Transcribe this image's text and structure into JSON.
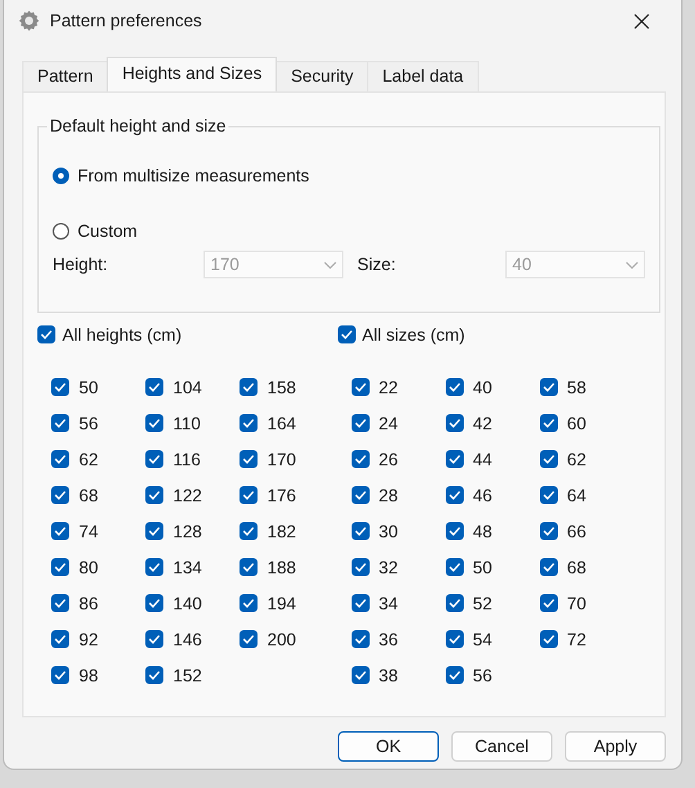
{
  "window": {
    "title": "Pattern preferences"
  },
  "tabs": [
    {
      "label": "Pattern",
      "selected": false
    },
    {
      "label": "Heights and Sizes",
      "selected": true
    },
    {
      "label": "Security",
      "selected": false
    },
    {
      "label": "Label data",
      "selected": false
    }
  ],
  "default_group": {
    "title": "Default height and size",
    "options": [
      {
        "label": "From multisize measurements",
        "selected": true
      },
      {
        "label": "Custom",
        "selected": false
      }
    ],
    "fields": [
      {
        "label": "Height:",
        "value": "170",
        "disabled": true
      },
      {
        "label": "Size:",
        "value": "40",
        "disabled": true
      }
    ]
  },
  "lists": [
    {
      "label": "All heights (cm)",
      "checked": true,
      "items": [
        {
          "label": "50",
          "checked": true
        },
        {
          "label": "56",
          "checked": true
        },
        {
          "label": "62",
          "checked": true
        },
        {
          "label": "68",
          "checked": true
        },
        {
          "label": "74",
          "checked": true
        },
        {
          "label": "80",
          "checked": true
        },
        {
          "label": "86",
          "checked": true
        },
        {
          "label": "92",
          "checked": true
        },
        {
          "label": "98",
          "checked": true
        },
        {
          "label": "104",
          "checked": true
        },
        {
          "label": "110",
          "checked": true
        },
        {
          "label": "116",
          "checked": true
        },
        {
          "label": "122",
          "checked": true
        },
        {
          "label": "128",
          "checked": true
        },
        {
          "label": "134",
          "checked": true
        },
        {
          "label": "140",
          "checked": true
        },
        {
          "label": "146",
          "checked": true
        },
        {
          "label": "152",
          "checked": true
        },
        {
          "label": "158",
          "checked": true
        },
        {
          "label": "164",
          "checked": true
        },
        {
          "label": "170",
          "checked": true
        },
        {
          "label": "176",
          "checked": true
        },
        {
          "label": "182",
          "checked": true
        },
        {
          "label": "188",
          "checked": true
        },
        {
          "label": "194",
          "checked": true
        },
        {
          "label": "200",
          "checked": true
        }
      ]
    },
    {
      "label": "All sizes (cm)",
      "checked": true,
      "items": [
        {
          "label": "22",
          "checked": true
        },
        {
          "label": "24",
          "checked": true
        },
        {
          "label": "26",
          "checked": true
        },
        {
          "label": "28",
          "checked": true
        },
        {
          "label": "30",
          "checked": true
        },
        {
          "label": "32",
          "checked": true
        },
        {
          "label": "34",
          "checked": true
        },
        {
          "label": "36",
          "checked": true
        },
        {
          "label": "38",
          "checked": true
        },
        {
          "label": "40",
          "checked": true
        },
        {
          "label": "42",
          "checked": true
        },
        {
          "label": "44",
          "checked": true
        },
        {
          "label": "46",
          "checked": true
        },
        {
          "label": "48",
          "checked": true
        },
        {
          "label": "50",
          "checked": true
        },
        {
          "label": "52",
          "checked": true
        },
        {
          "label": "54",
          "checked": true
        },
        {
          "label": "56",
          "checked": true
        },
        {
          "label": "58",
          "checked": true
        },
        {
          "label": "60",
          "checked": true
        },
        {
          "label": "62",
          "checked": true
        },
        {
          "label": "64",
          "checked": true
        },
        {
          "label": "66",
          "checked": true
        },
        {
          "label": "68",
          "checked": true
        },
        {
          "label": "70",
          "checked": true
        },
        {
          "label": "72",
          "checked": true
        }
      ]
    }
  ],
  "buttons": [
    {
      "label": "OK",
      "default": true
    },
    {
      "label": "Cancel",
      "default": false
    },
    {
      "label": "Apply",
      "default": false
    }
  ]
}
